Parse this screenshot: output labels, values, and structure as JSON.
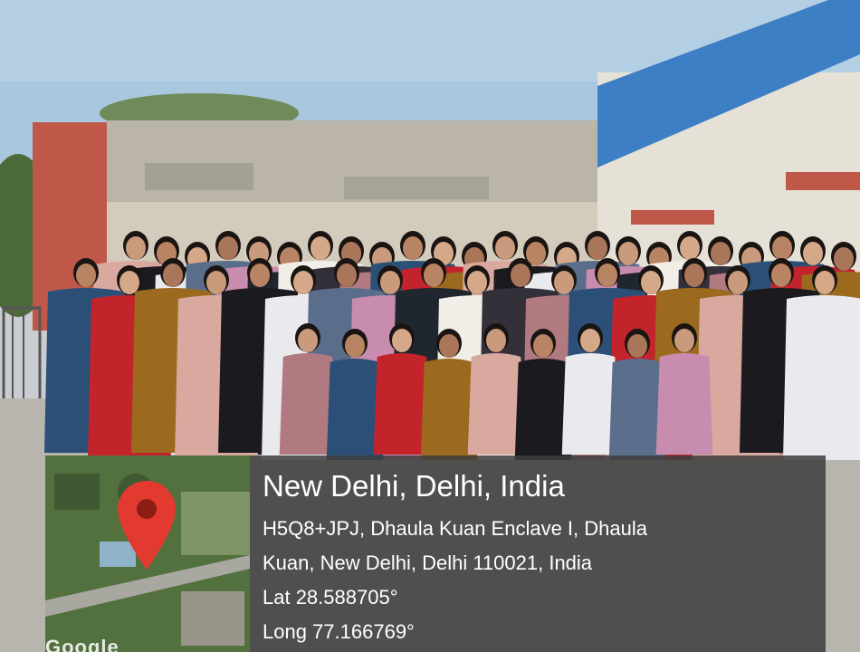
{
  "geotag": {
    "place_title": "New Delhi, Delhi, India",
    "address_line_1": "H5Q8+JPJ, Dhaula Kuan Enclave I, Dhaula",
    "address_line_2": "Kuan, New Delhi, Delhi 110021, India",
    "latitude": "Lat 28.588705°",
    "longitude": "Long 77.166769°",
    "map_attribution": "Google"
  },
  "colors": {
    "sky": "#a9c7de",
    "wall": "#d8d2c5",
    "roof": "#3d7fc4",
    "pin": "#e23a2f",
    "overlay": "#3e3e3e"
  },
  "icons": {
    "location_pin": "map-pin-icon"
  }
}
